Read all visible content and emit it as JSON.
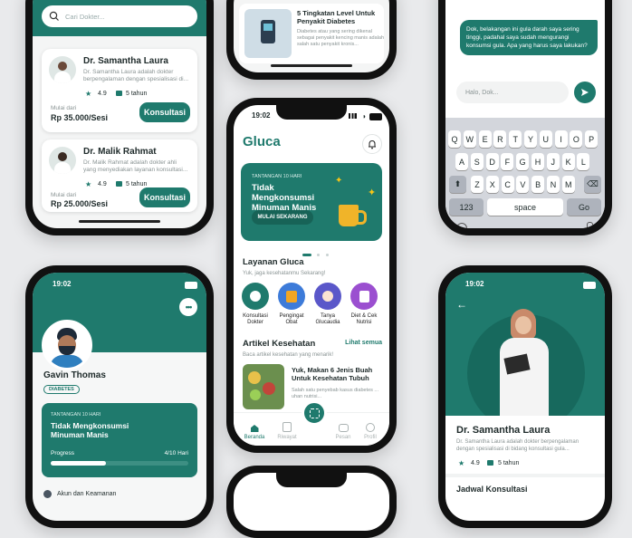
{
  "brand_color": "#1f7a6d",
  "doctor_list": {
    "search_placeholder": "Cari Dokter...",
    "doctors": [
      {
        "name": "Dr. Samantha Laura",
        "desc": "Dr. Samantha Laura adalah dokter berpengalaman dengan spesialisasi di...",
        "rating": "4.9",
        "years": "5 tahun",
        "from_label": "Mulai dari",
        "price": "Rp 35.000/Sesi",
        "button": "Konsultasi"
      },
      {
        "name": "Dr. Malik Rahmat",
        "desc": "Dr. Malik Rahmat adalah dokter ahli yang menyediakan layanan konsultasi...",
        "rating": "4.9",
        "years": "5 tahun",
        "from_label": "Mulai dari",
        "price": "Rp 25.000/Sesi",
        "button": "Konsultasi"
      }
    ]
  },
  "article_top": {
    "title": "5 Tingkatan Level Untuk Penyakit Diabetes",
    "desc": "Diabetes atau yang sering dikenal sebagai penyakit kencing manis adalah salah satu penyakit kronis..."
  },
  "chat": {
    "message": "Dok, belakangan ini gula darah saya sering tinggi, padahal saya sudah mengurangi konsumsi gula. Apa yang harus saya lakukan?",
    "input_placeholder": "Halo, Dok...",
    "keys_row1": [
      "Q",
      "W",
      "E",
      "R",
      "T",
      "Y",
      "U",
      "I",
      "O",
      "P"
    ],
    "keys_row2": [
      "A",
      "S",
      "D",
      "F",
      "G",
      "H",
      "J",
      "K",
      "L"
    ],
    "keys_row3": [
      "Z",
      "X",
      "C",
      "V",
      "B",
      "N",
      "M"
    ],
    "key_123": "123",
    "key_space": "space",
    "key_go": "Go"
  },
  "home": {
    "time": "19:02",
    "logo": "Gluca",
    "challenge_tag": "TANTANGAN 10 HARI",
    "challenge_title": "Tidak Mengkonsumsi Minuman Manis",
    "challenge_button": "MULAI SEKARANG",
    "services_title": "Layanan Gluca",
    "services_subtitle": "Yuk, jaga kesehatanmu Sekarang!",
    "services": [
      {
        "label": "Konsultasi Dokter",
        "color": "#1f7a6d"
      },
      {
        "label": "Pengingat Obat",
        "color": "#f2a623"
      },
      {
        "label": "Tanya Glucaudia",
        "color": "#5a57c9"
      },
      {
        "label": "Diet & Cek Nutrisi",
        "color": "#9b4fd0"
      }
    ],
    "articles_title": "Artikel Kesehatan",
    "articles_link": "Lihat semua",
    "articles_subtitle": "Baca artikel kesehatan yang menarik!",
    "article_title": "Yuk, Makan 6 Jenis Buah Untuk Kesehatan Tubuh",
    "article_desc": "Salah satu penyebab kasus diabetes ... uhan nutrisi...",
    "nav": [
      "Beranda",
      "Riwayat",
      "Pesan",
      "Profil"
    ]
  },
  "profile": {
    "time": "19:02",
    "name": "Gavin Thomas",
    "badge": "DIABETES",
    "challenge_tag": "TANTANGAN 10 HARI",
    "challenge_title": "Tidak Mengkonsumsi Minuman Manis",
    "progress_label": "Progress",
    "progress_value": "4/10 Hari",
    "progress_fraction": 0.4,
    "menu_item": "Akun dan Keamanan"
  },
  "doctor_detail": {
    "time": "19:02",
    "name": "Dr. Samantha Laura",
    "desc": "Dr. Samantha Laura adalah dokter berpengalaman dengan spesialisasi di bidang konsultasi gula...",
    "rating": "4.9",
    "years": "5 tahun",
    "section": "Jadwal Konsultasi"
  }
}
